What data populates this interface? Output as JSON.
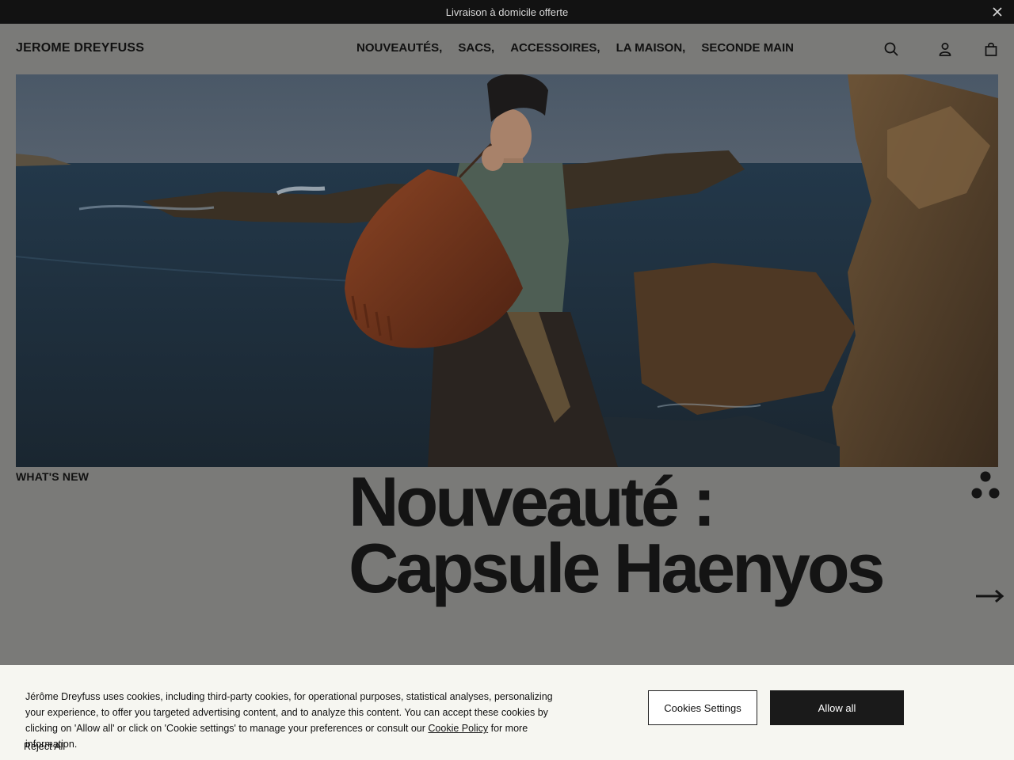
{
  "announcement": {
    "text": "Livraison à domicile offerte",
    "close_icon": "close-icon"
  },
  "header": {
    "logo": "JEROME DREYFUSS",
    "nav": [
      "NOUVEAUTÉS,",
      "SACS,",
      "ACCESSOIRES,",
      "LA MAISON,",
      "SECONDE MAIN"
    ],
    "icons": [
      "search-icon",
      "account-icon",
      "bag-icon"
    ]
  },
  "hero": {
    "eyebrow": "WHAT'S NEW",
    "title_line1": "Nouveauté :",
    "title_line2": "Capsule Haenyos"
  },
  "cookie": {
    "text_before_link": "Jérôme Dreyfuss uses cookies, including third-party cookies, for operational purposes, statistical analyses, personalizing your experience, to offer you targeted advertising content, and to analyze this content. You can accept these cookies by clicking on 'Allow all' or click on 'Cookie settings' to manage your preferences or consult our ",
    "link": "Cookie Policy",
    "text_after_link": " for more information.",
    "reject": "Reject All",
    "settings_button": "Cookies Settings",
    "allow_button": "Allow all"
  },
  "colors": {
    "overlay": "#7a7a78",
    "dark": "#121212",
    "banner_bg": "#f6f6f1"
  }
}
